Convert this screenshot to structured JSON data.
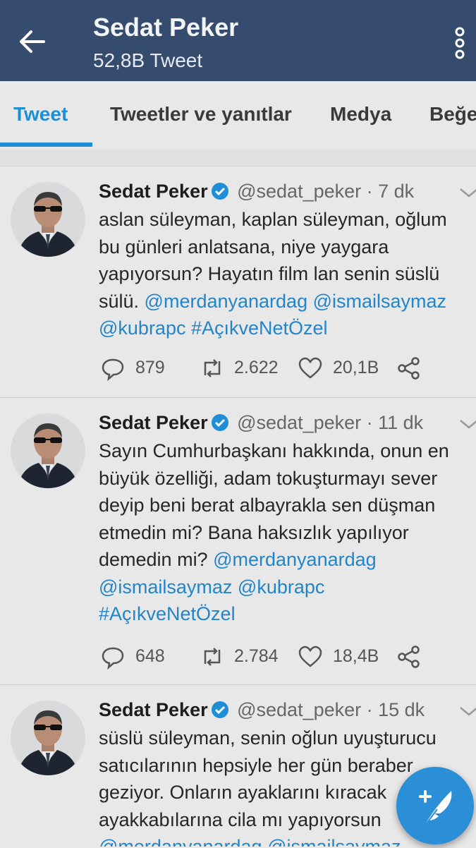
{
  "header": {
    "title": "Sedat Peker",
    "subtitle": "52,8B Tweet"
  },
  "tabs": [
    "Tweet",
    "Tweetler ve yanıtlar",
    "Medya",
    "Beğe"
  ],
  "tweets": [
    {
      "name": "Sedat Peker",
      "handle": "@sedat_peker",
      "time": "· 7 dk",
      "body": {
        "l1": "aslan süleyman, kaplan süleyman, oğlum",
        "l2": "bu günleri anlatsana, niye yaygara",
        "l3": "yapıyorsun?  Hayatın film lan senin süslü",
        "l4_text": "sülü. ",
        "l4_link": "@merdanyanardag @ismailsaymaz",
        "l5_link": "@kubrapc #AçıkveNetÖzel"
      },
      "replies": "879",
      "retweets": "2.622",
      "likes": "20,1B"
    },
    {
      "name": "Sedat Peker",
      "handle": "@sedat_peker",
      "time": "· 11 dk",
      "body": {
        "l1": "Sayın Cumhurbaşkanı hakkında, onun en",
        "l2": "büyük özelliği, adam tokuşturmayı sever",
        "l3": "deyip beni berat albayrakla sen düşman",
        "l4": "etmedin mi? Bana haksızlık yapılıyor",
        "l5_text": "demedin mi? ",
        "l5_link": "@merdanyanardag",
        "l6_link": "@ismailsaymaz @kubrapc",
        "l7_link": "#AçıkveNetÖzel"
      },
      "replies": "648",
      "retweets": "2.784",
      "likes": "18,4B"
    },
    {
      "name": "Sedat Peker",
      "handle": "@sedat_peker",
      "time": "· 15 dk",
      "body": {
        "l1": "süslü süleyman, senin oğlun uyuşturucu",
        "l2": "satıcılarının hepsiyle her gün beraber",
        "l3": "geziyor. Onların ayaklarını kıracak",
        "l4": "ayakkabılarına cila mı yapıyorsun",
        "l5_link": "@merdanyanardag @ismailsaymaz"
      }
    }
  ],
  "colors": {
    "header_bg": "#364c6e",
    "accent": "#1e8fd6",
    "link": "#2285c9",
    "fab": "#2a8fd6"
  },
  "icons": [
    "back-arrow-icon",
    "more-vert-icon",
    "verified-badge-icon",
    "chevron-down-icon",
    "reply-icon",
    "retweet-icon",
    "like-icon",
    "share-icon",
    "compose-tweet-icon"
  ]
}
